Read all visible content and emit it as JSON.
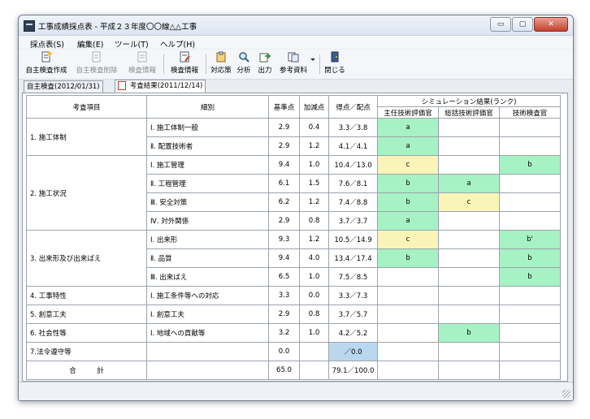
{
  "window": {
    "title": "工事成績採点表 - 平成２３年度〇〇線△△工事",
    "buttons": {
      "minimize": "▭",
      "maximize": "▢",
      "close": "✕"
    }
  },
  "menu": [
    "採点表(S)",
    "編集(E)",
    "ツール(T)",
    "ヘルプ(H)"
  ],
  "toolbar": [
    {
      "label": "自主検査作成",
      "icon": "new-doc-icon",
      "enabled": true
    },
    {
      "label": "自主検査削除",
      "icon": "delete-doc-icon",
      "enabled": false
    },
    {
      "label": "検査情報",
      "icon": "info-doc-icon",
      "enabled": false
    },
    {
      "label": "検査情報",
      "icon": "info-doc-edit-icon",
      "enabled": true
    },
    {
      "label": "対応策",
      "icon": "clipboard-icon",
      "enabled": true
    },
    {
      "label": "分析",
      "icon": "magnifier-icon",
      "enabled": true
    },
    {
      "label": "出力",
      "icon": "export-icon",
      "enabled": true
    },
    {
      "label": "参考資料",
      "icon": "reference-icon",
      "enabled": true
    },
    {
      "label": "閉じる",
      "icon": "exit-icon",
      "enabled": true
    }
  ],
  "tabs": [
    {
      "label": "自主検査(2012/01/31)",
      "active": false
    },
    {
      "label": "考査結果(2011/12/14)",
      "active": true
    }
  ],
  "table": {
    "headers": {
      "item": "考査項目",
      "detail": "細別",
      "base": "基準点",
      "add": "加減点",
      "score": "得点／配点",
      "sim": "シミュレーション結果(ランク)",
      "sim_cols": [
        "主任技術評価官",
        "総括技術評価官",
        "技術検査官"
      ]
    },
    "rows": [
      {
        "category": "1. 施工体制",
        "span": 2,
        "detail": "Ⅰ. 施工体制一般",
        "base": "2.9",
        "add": "0.4",
        "score": "3.3／3.8",
        "ranks": [
          "a",
          "",
          ""
        ],
        "colors": [
          "g",
          "",
          ""
        ]
      },
      {
        "detail": "Ⅱ. 配置技術者",
        "base": "2.9",
        "add": "1.2",
        "score": "4.1／4.1",
        "ranks": [
          "a",
          "",
          ""
        ],
        "colors": [
          "g",
          "",
          ""
        ]
      },
      {
        "category": "2. 施工状況",
        "span": 4,
        "detail": "Ⅰ. 施工管理",
        "base": "9.4",
        "add": "1.0",
        "score": "10.4／13.0",
        "ranks": [
          "c",
          "",
          "b"
        ],
        "colors": [
          "y",
          "",
          "g"
        ]
      },
      {
        "detail": "Ⅱ. 工程管理",
        "base": "6.1",
        "add": "1.5",
        "score": "7.6／8.1",
        "ranks": [
          "b",
          "a",
          ""
        ],
        "colors": [
          "g",
          "g",
          ""
        ]
      },
      {
        "detail": "Ⅲ. 安全対策",
        "base": "6.2",
        "add": "1.2",
        "score": "7.4／8.8",
        "ranks": [
          "b",
          "c",
          ""
        ],
        "colors": [
          "g",
          "y",
          ""
        ]
      },
      {
        "detail": "Ⅳ. 対外関係",
        "base": "2.9",
        "add": "0.8",
        "score": "3.7／3.7",
        "ranks": [
          "a",
          "",
          ""
        ],
        "colors": [
          "g",
          "",
          ""
        ]
      },
      {
        "category": "3. 出来形及び出来ばえ",
        "span": 3,
        "detail": "Ⅰ. 出来形",
        "base": "9.3",
        "add": "1.2",
        "score": "10.5／14.9",
        "ranks": [
          "c",
          "",
          "b'"
        ],
        "colors": [
          "y",
          "",
          "g"
        ]
      },
      {
        "detail": "Ⅱ. 品質",
        "base": "9.4",
        "add": "4.0",
        "score": "13.4／17.4",
        "ranks": [
          "b",
          "",
          "b"
        ],
        "colors": [
          "g",
          "",
          "g"
        ]
      },
      {
        "detail": "Ⅲ. 出来ばえ",
        "base": "6.5",
        "add": "1.0",
        "score": "7.5／8.5",
        "ranks": [
          "",
          "",
          "b"
        ],
        "colors": [
          "",
          "",
          "g"
        ]
      },
      {
        "category": "4. 工事特性",
        "span": 1,
        "detail": "Ⅰ. 施工条件等への対応",
        "base": "3.3",
        "add": "0.0",
        "score": "3.3／7.3",
        "ranks": [
          "",
          "",
          ""
        ],
        "colors": [
          "",
          "",
          ""
        ]
      },
      {
        "category": "5. 創意工夫",
        "span": 1,
        "detail": "Ⅰ. 創意工夫",
        "base": "2.9",
        "add": "0.8",
        "score": "3.7／5.7",
        "ranks": [
          "",
          "",
          ""
        ],
        "colors": [
          "",
          "",
          ""
        ]
      },
      {
        "category": "6. 社会性等",
        "span": 1,
        "detail": "Ⅰ. 地域への貢献等",
        "base": "3.2",
        "add": "1.0",
        "score": "4.2／5.2",
        "ranks": [
          "",
          "b",
          ""
        ],
        "colors": [
          "",
          "g",
          ""
        ]
      },
      {
        "category": "7.法令遵守等",
        "span": 1,
        "detail": "",
        "base": "0.0",
        "add": "",
        "score": "／0.0",
        "score_color": "b",
        "ranks": [
          "",
          "",
          ""
        ],
        "colors": [
          "",
          "",
          ""
        ]
      }
    ],
    "total": {
      "label": "合　　　計",
      "base": "65.0",
      "score": "79.1／100.0"
    }
  },
  "colors": {
    "green": "#a6f2c4",
    "yellow": "#f9f5b8",
    "blue": "#b9d8ef"
  }
}
